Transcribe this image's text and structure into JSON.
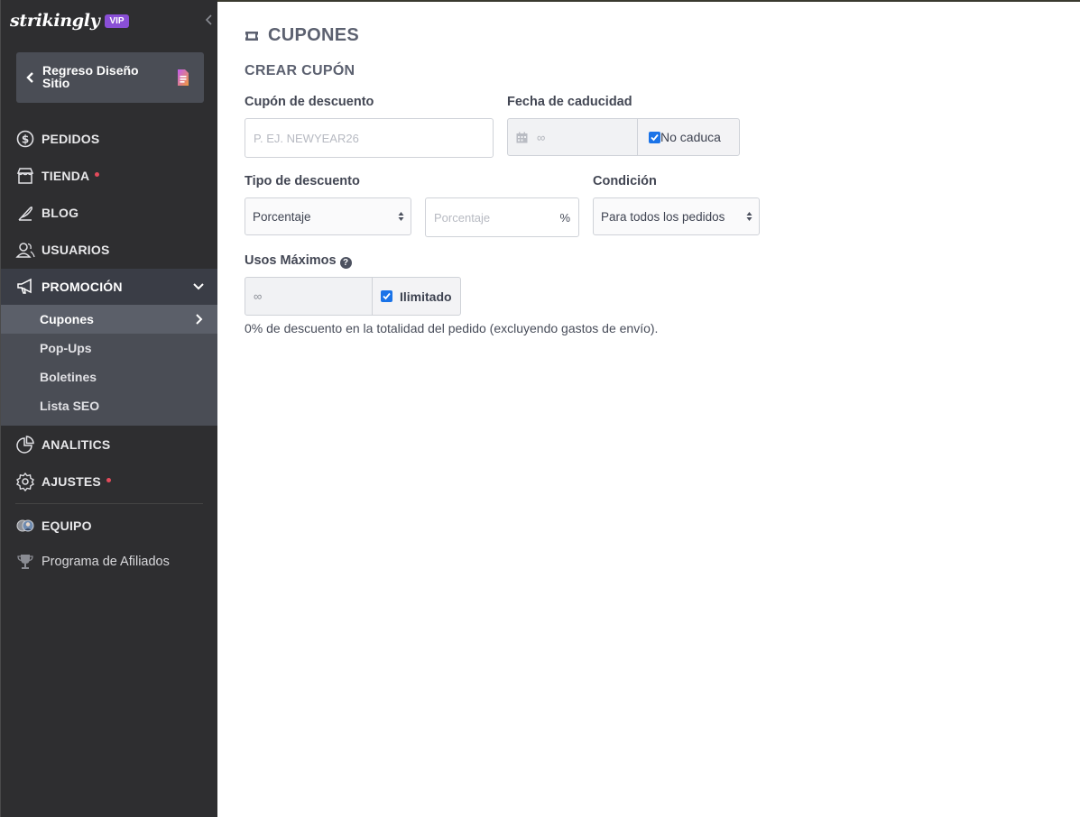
{
  "sidebar": {
    "logo": "strikingly",
    "badge": "VIP",
    "back_label": "Regreso Diseño Sitio",
    "nav": {
      "pedidos": "PEDIDOS",
      "tienda": "TIENDA",
      "blog": "BLOG",
      "usuarios": "USUARIOS",
      "promocion": "PROMOCIÓN",
      "analitics": "ANALITICS",
      "ajustes": "AJUSTES",
      "equipo": "EQUIPO",
      "afiliados": "Programa de Afiliados"
    },
    "submenu": {
      "cupones": "Cupones",
      "popups": "Pop-Ups",
      "boletines": "Boletines",
      "seo": "Lista SEO"
    },
    "colors": {
      "badge": "#8a4fd6",
      "notification_dot": "#e34b5b"
    }
  },
  "main": {
    "title": "CUPONES",
    "subtitle": "CREAR CUPÓN",
    "coupon": {
      "label": "Cupón de descuento",
      "placeholder": "P. EJ. NEWYEAR26"
    },
    "expiry": {
      "label": "Fecha de caducidad",
      "value": "∞",
      "checkbox_label": "No caduca",
      "checked": true
    },
    "discount_type": {
      "label": "Tipo de descuento",
      "selected": "Porcentaje",
      "amount_placeholder": "Porcentaje",
      "unit": "%"
    },
    "condition": {
      "label": "Condición",
      "selected": "Para todos los pedidos"
    },
    "max_uses": {
      "label": "Usos Máximos",
      "help": "?",
      "value": "∞",
      "checkbox_label": "Ilimitado",
      "checked": true
    },
    "summary": "0% de descuento en la totalidad del pedido (excluyendo gastos de envío)."
  }
}
